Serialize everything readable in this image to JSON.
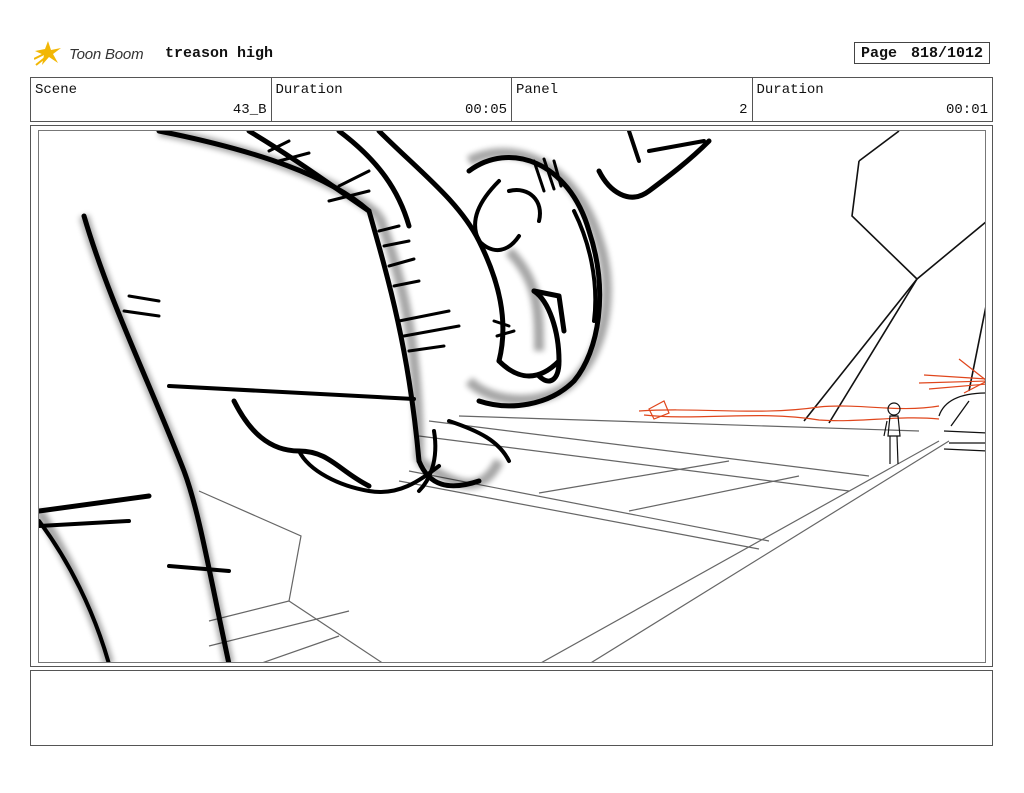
{
  "header": {
    "logo_text": "Toon Boom",
    "project_title": "treason high",
    "page_label": "Page",
    "page_number": "818/1012"
  },
  "info": {
    "scene_label": "Scene",
    "scene_value": "43_B",
    "duration_label": "Duration",
    "duration_value": "00:05",
    "panel_label": "Panel",
    "panel_value": "2",
    "panel_duration_label": "Duration",
    "panel_duration_value": "00:01"
  },
  "colors": {
    "logo_star": "#f2b705",
    "sketch_line": "#000000",
    "laser": "#e0461c",
    "frame": "#555555"
  },
  "notes": {
    "text": ""
  }
}
